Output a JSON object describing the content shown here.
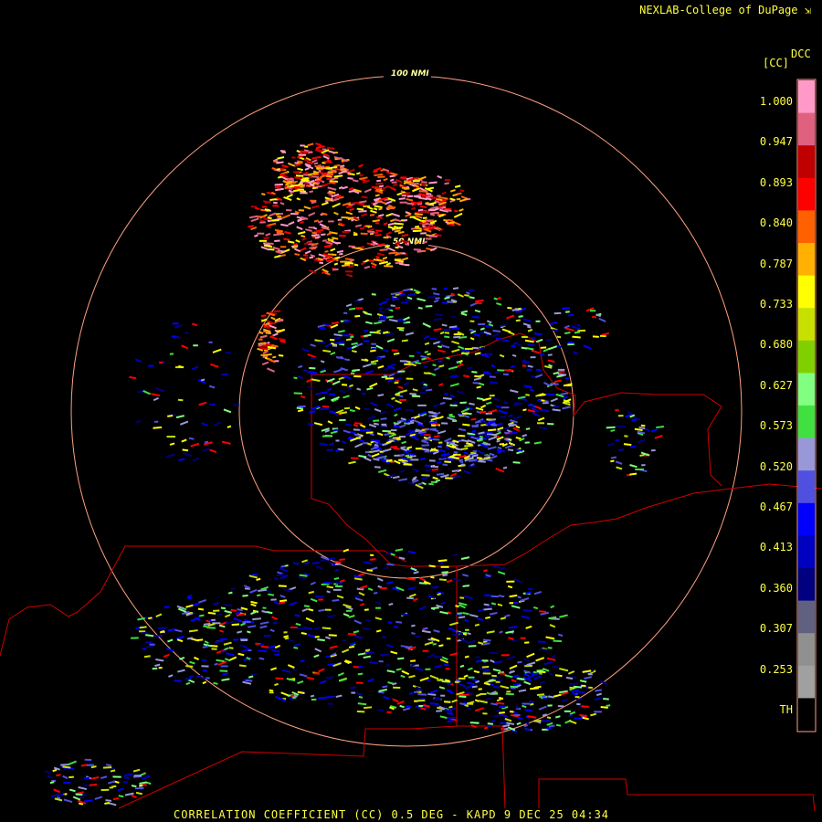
{
  "header": {
    "credit": "NEXLAB-College of DuPage",
    "credit_icon": "corner-arrow-icon"
  },
  "footer": {
    "caption": "CORRELATION COEFFICIENT (CC) 0.5 DEG - KAPD 9 DEC 25 04:34"
  },
  "legend": {
    "product": "DCC",
    "unit": "[CC]",
    "ticks": [
      "1.000",
      "0.947",
      "0.893",
      "0.840",
      "0.787",
      "0.733",
      "0.680",
      "0.627",
      "0.573",
      "0.520",
      "0.467",
      "0.413",
      "0.360",
      "0.307",
      "0.253",
      "TH"
    ],
    "colors": [
      "#ff9ac8",
      "#e06080",
      "#c00000",
      "#ff0000",
      "#ff6000",
      "#ffb000",
      "#ffff00",
      "#c8e000",
      "#80d000",
      "#80ff80",
      "#40e040",
      "#9898d8",
      "#5050e0",
      "#0000ff",
      "#0000c0",
      "#000080",
      "#606080",
      "#909090",
      "#a0a0a0",
      "#000000"
    ]
  },
  "map": {
    "range_rings": [
      "100 NMI",
      "50 NMI"
    ],
    "ring_color": "#ffa080",
    "border_color": "#d00000"
  }
}
